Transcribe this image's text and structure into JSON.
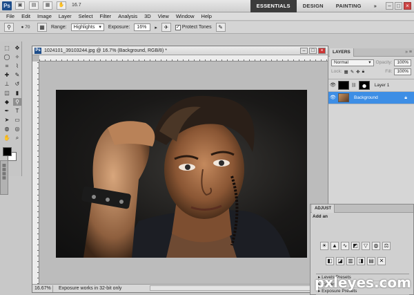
{
  "app": {
    "logo": "Ps",
    "zoom_mini": "16.7",
    "workspaces": [
      "ESSENTIALS",
      "DESIGN",
      "PAINTING"
    ],
    "workspace_more": "»",
    "menu": [
      "File",
      "Edit",
      "Image",
      "Layer",
      "Select",
      "Filter",
      "Analysis",
      "3D",
      "View",
      "Window",
      "Help"
    ]
  },
  "options": {
    "brush_size": "70",
    "range_label": "Range:",
    "range_value": "Highlights",
    "exposure_label": "Exposure:",
    "exposure_value": "16%",
    "protect_tones_label": "Protect Tones",
    "protect_tones_checked": "✓"
  },
  "document": {
    "title": "1024101_39103244.jpg @ 16.7% (Background, RGB/8) *",
    "ps_badge": "Ps",
    "zoom": "16.67%",
    "status": "Exposure works in 32-bit only"
  },
  "layers": {
    "tab": "LAYERS",
    "blend_mode": "Normal",
    "opacity_label": "Opacity:",
    "opacity_value": "100%",
    "lock_label": "Lock:",
    "fill_label": "Fill:",
    "fill_value": "100%",
    "items": [
      {
        "name": "Layer 1",
        "active": false
      },
      {
        "name": "Background",
        "active": true
      }
    ]
  },
  "adjustments": {
    "tab": "ADJUST",
    "subtitle": "Add an",
    "presets": [
      "Levels Presets",
      "Curves",
      "Exposure Presets"
    ]
  },
  "watermark": "pxleyes.com"
}
